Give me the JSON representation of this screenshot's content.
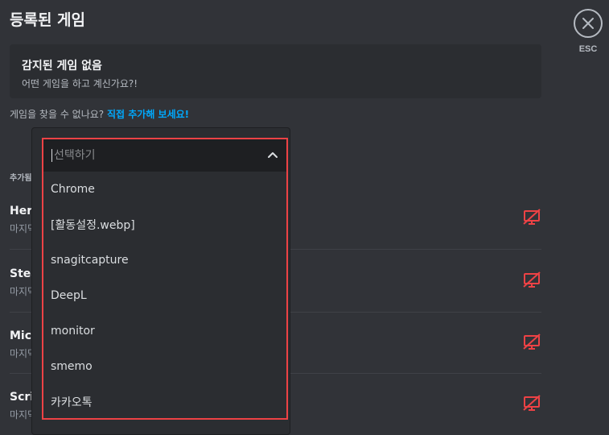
{
  "page_title": "등록된 게임",
  "close_label": "ESC",
  "no_game": {
    "title": "감지된 게임 없음",
    "subtitle": "어떤 게임을 하고 계신가요?!"
  },
  "not_found": {
    "text": "게임을 찾을 수 없나요? ",
    "link": "직접 추가해 보세요!"
  },
  "section_label": "추가됨",
  "games": [
    {
      "name": "Hero",
      "last": "마지막"
    },
    {
      "name": "Steam",
      "last": "마지막"
    },
    {
      "name": "Micro",
      "last": "마지막"
    },
    {
      "name": "Scrive",
      "last": "마지막"
    }
  ],
  "dropdown": {
    "placeholder": "선택하기",
    "options": [
      "Chrome",
      "[활동설정.webp]",
      "snagitcapture",
      "DeepL",
      "monitor",
      "smemo",
      "카카오톡"
    ]
  },
  "colors": {
    "background": "#313338",
    "card": "#2b2d31",
    "link": "#00a8fc",
    "highlight": "#ed4245",
    "overlay_icon": "#ed4245"
  },
  "icons": {
    "close": "close-icon",
    "chevron": "chevron-up-icon",
    "overlay": "overlay-off-icon"
  }
}
